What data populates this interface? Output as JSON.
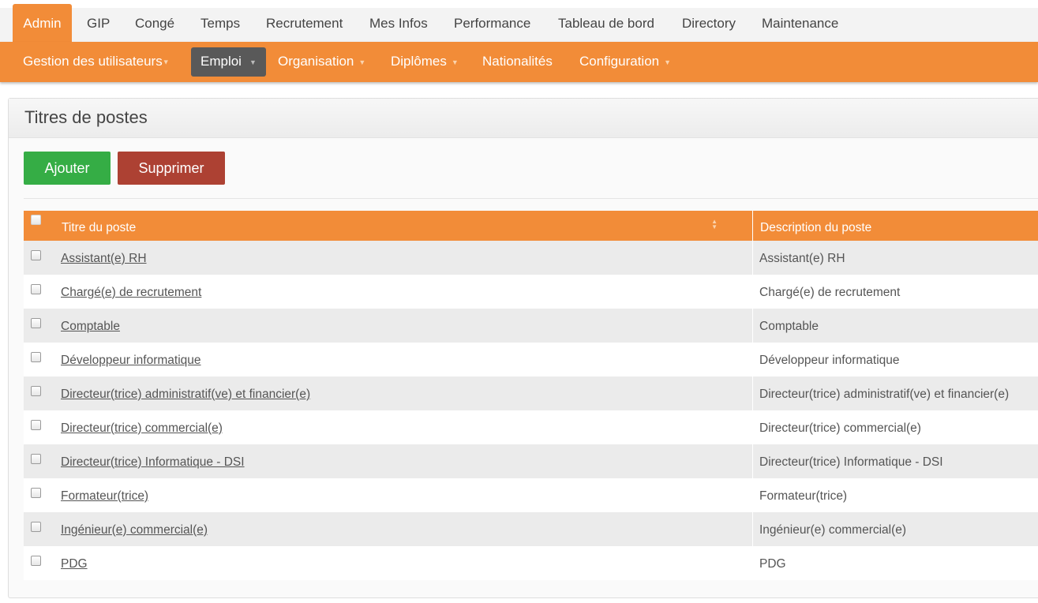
{
  "top_menu": [
    {
      "label": "Admin",
      "active": true
    },
    {
      "label": "GIP"
    },
    {
      "label": "Congé"
    },
    {
      "label": "Temps"
    },
    {
      "label": "Recrutement"
    },
    {
      "label": "Mes Infos"
    },
    {
      "label": "Performance"
    },
    {
      "label": "Tableau de bord"
    },
    {
      "label": "Directory"
    },
    {
      "label": "Maintenance"
    }
  ],
  "sub_menu": [
    {
      "label": "Gestion des utilisateurs",
      "dropdown": true
    },
    {
      "label": "Emploi",
      "dropdown": true,
      "active": true
    },
    {
      "label": "Organisation",
      "dropdown": true
    },
    {
      "label": "Diplômes",
      "dropdown": true
    },
    {
      "label": "Nationalités",
      "dropdown": false
    },
    {
      "label": "Configuration",
      "dropdown": true
    }
  ],
  "panel": {
    "title": "Titres de postes",
    "add_label": "Ajouter",
    "delete_label": "Supprimer"
  },
  "table": {
    "headers": {
      "title": "Titre du poste",
      "description": "Description du poste"
    },
    "rows": [
      {
        "title": "Assistant(e) RH",
        "description": "Assistant(e) RH"
      },
      {
        "title": "Chargé(e) de recrutement",
        "description": "Chargé(e) de recrutement"
      },
      {
        "title": "Comptable",
        "description": "Comptable"
      },
      {
        "title": "Développeur informatique",
        "description": "Développeur informatique"
      },
      {
        "title": "Directeur(trice) administratif(ve) et financier(e)",
        "description": "Directeur(trice) administratif(ve) et financier(e)"
      },
      {
        "title": "Directeur(trice) commercial(e)",
        "description": "Directeur(trice) commercial(e)"
      },
      {
        "title": "Directeur(trice) Informatique - DSI",
        "description": "Directeur(trice) Informatique - DSI"
      },
      {
        "title": "Formateur(trice)",
        "description": "Formateur(trice)"
      },
      {
        "title": "Ingénieur(e) commercial(e)",
        "description": "Ingénieur(e) commercial(e)"
      },
      {
        "title": "PDG",
        "description": "PDG"
      }
    ]
  },
  "colors": {
    "accent": "#f28c38",
    "add_button": "#35ad45",
    "delete_button": "#ad4133",
    "active_submenu": "#595959"
  },
  "icons": {
    "dropdown": "caret-down-icon",
    "sort": "sort-icon"
  }
}
